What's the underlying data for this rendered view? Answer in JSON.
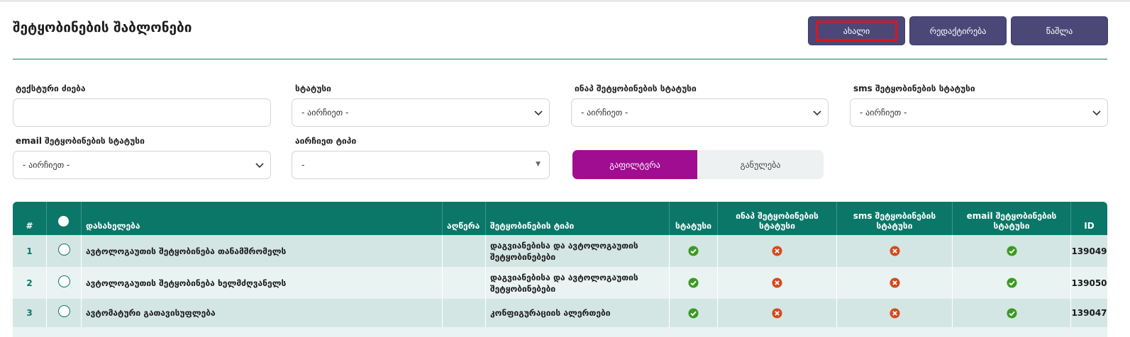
{
  "page": {
    "title": "შეტყობინების შაბლონები"
  },
  "toolbar": {
    "new_label": "ახალი",
    "edit_label": "რედაქტირება",
    "delete_label": "წაშლა"
  },
  "filters": {
    "text_search": {
      "label": "ტექსტური ძიება",
      "value": ""
    },
    "status": {
      "label": "სტატუსი",
      "selected": "- აირჩიეთ -"
    },
    "inapp_status": {
      "label": "ინაპ შეტყობინების სტატუსი",
      "selected": "- აირჩიეთ -"
    },
    "sms_status": {
      "label": "sms შეტყობინების სტატუსი",
      "selected": "- აირჩიეთ -"
    },
    "email_status": {
      "label": "email შეტყობინების სტატუსი",
      "selected": "- აირჩიეთ -"
    },
    "type": {
      "label": "აირჩიეთ ტიპი",
      "selected": "-"
    },
    "filter_button": "გაფილტვრა",
    "reset_button": "განულება"
  },
  "table": {
    "headers": {
      "num": "#",
      "name": "დასახელება",
      "description": "აღწერა",
      "type": "შეტყობინების ტიპი",
      "status": "სტატუსი",
      "inapp_status": "ინაპ შეტყობინების სტატუსი",
      "sms_status": "sms შეტყობინების სტატუსი",
      "email_status": "email შეტყობინების სტატუსი",
      "id": "ID"
    },
    "rows": [
      {
        "num": "1",
        "name": "ავტოლოგაუთის შეტყობინება თანამშრომელს",
        "description": "",
        "type": "დაგვიანებისა და ავტოლოგაუთის შეტყობინებები",
        "status": "check-icon",
        "inapp": "cross-icon",
        "sms": "cross-icon",
        "email": "check-icon",
        "id": "139049"
      },
      {
        "num": "2",
        "name": "ავტოლოგაუთის შეტყობინება ხელმძღვანელს",
        "description": "",
        "type": "დაგვიანებისა და ავტოლოგაუთის შეტყობინებები",
        "status": "check-icon",
        "inapp": "cross-icon",
        "sms": "cross-icon",
        "email": "check-icon",
        "id": "139050"
      },
      {
        "num": "3",
        "name": "ავტომატური გათავისუფლება",
        "description": "",
        "type": "კონფიგურაციის ალერთები",
        "status": "check-icon",
        "inapp": "cross-icon",
        "sms": "cross-icon",
        "email": "check-icon",
        "id": "139047"
      }
    ]
  },
  "colors": {
    "header_teal": "#0b7768",
    "button_purple": "#4b4878",
    "filter_magenta": "#a00d91",
    "row_dark": "#d4e6e3",
    "row_light": "#e9f3f1",
    "check_green": "#3a9a22",
    "cross_red": "#d44a1e",
    "highlight_red": "#e1141b"
  }
}
